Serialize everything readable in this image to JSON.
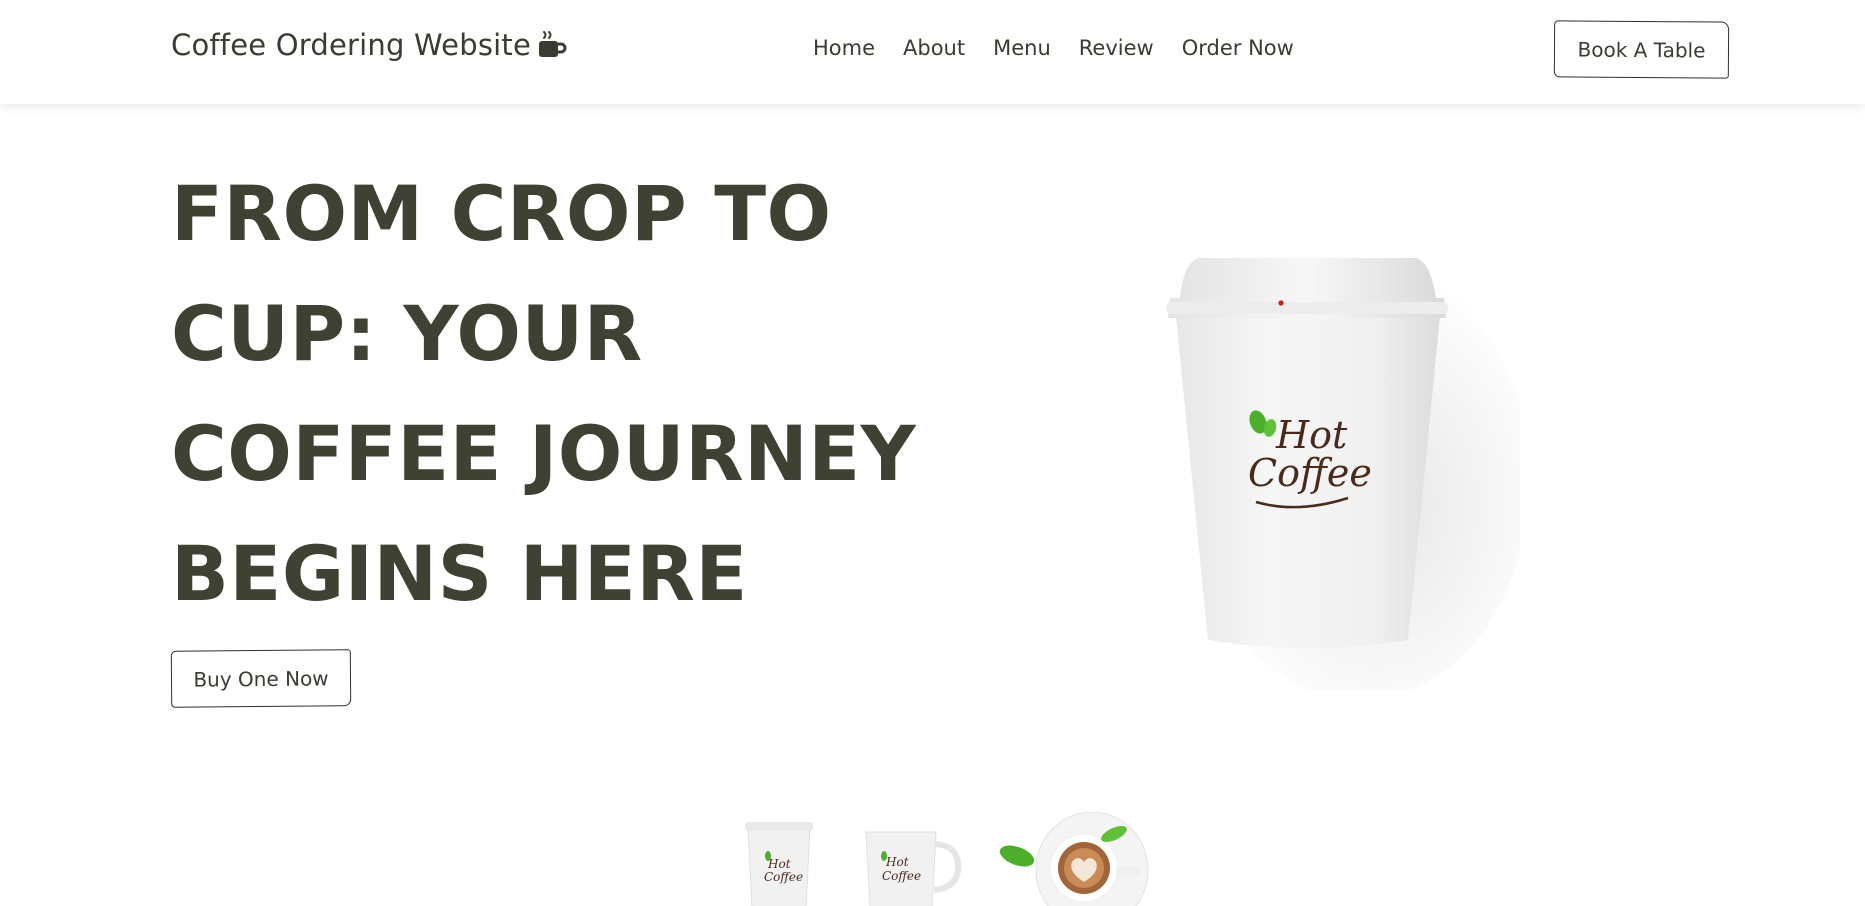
{
  "header": {
    "logo_text": "Coffee Ordering Website",
    "logo_icon": "mug-hot-icon",
    "nav": [
      {
        "label": "Home"
      },
      {
        "label": "About"
      },
      {
        "label": "Menu"
      },
      {
        "label": "Review"
      },
      {
        "label": "Order Now"
      }
    ],
    "book_button": "Book A Table"
  },
  "hero": {
    "title": "FROM CROP TO CUP: YOUR COFFEE JOURNEY BEGINS HERE",
    "buy_button": "Buy One Now",
    "cup_logo_line1": "Hot",
    "cup_logo_line2": "Coffee"
  },
  "thumbnails": [
    {
      "name": "paper-cup",
      "logo_line1": "Hot",
      "logo_line2": "Coffee"
    },
    {
      "name": "mug",
      "logo_line1": "Hot",
      "logo_line2": "Coffee"
    },
    {
      "name": "latte-cup"
    }
  ],
  "colors": {
    "text_dark": "#3f4133",
    "leaf_green": "#4caf2a",
    "logo_brown": "#4a2a1a"
  }
}
